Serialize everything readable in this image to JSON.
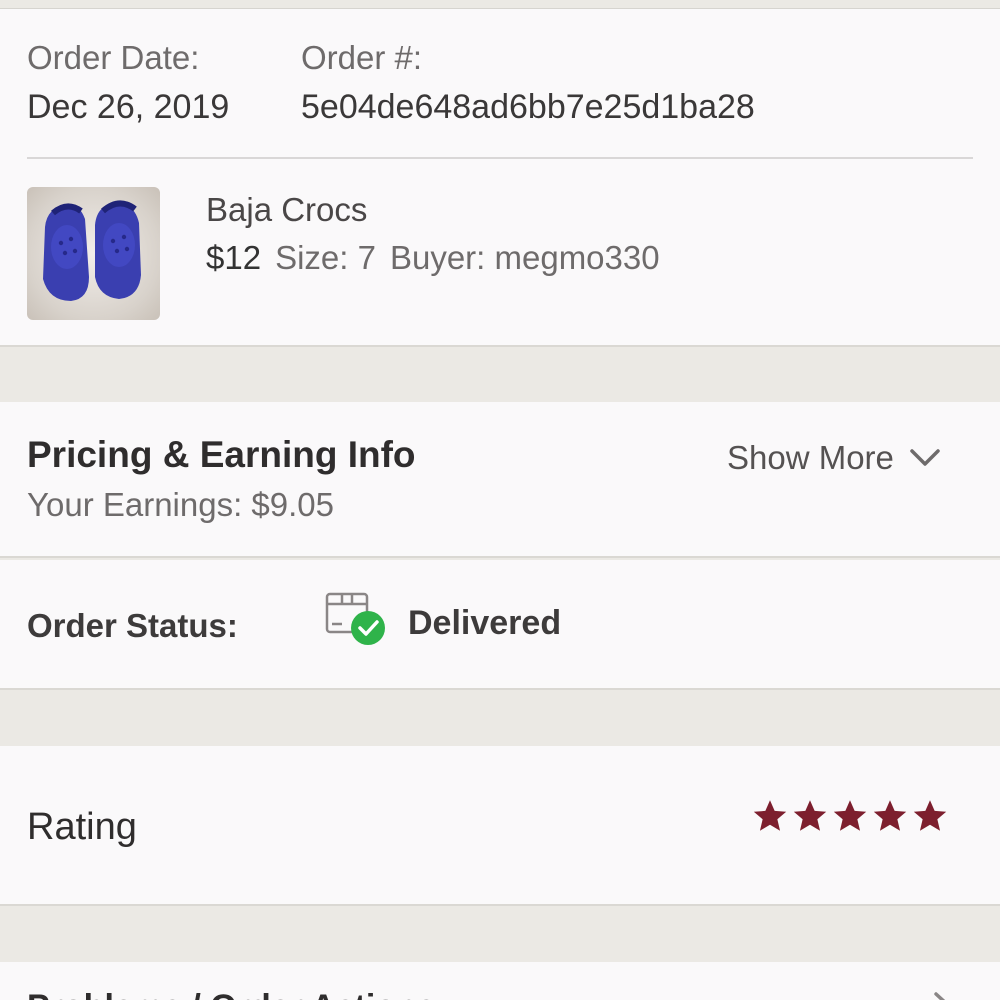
{
  "order": {
    "date_label": "Order Date:",
    "date_value": "Dec 26, 2019",
    "number_label": "Order #:",
    "number_value": "5e04de648ad6bb7e25d1ba28"
  },
  "item": {
    "thumbnail_icon": "crocs-photo",
    "name": "Baja Crocs",
    "price": "$12",
    "size": "Size: 7",
    "buyer": "Buyer: megmo330"
  },
  "pricing": {
    "title": "Pricing & Earning Info",
    "earnings": "Your Earnings: $9.05",
    "show_more": "Show More",
    "chevron_icon": "chevron-down-icon"
  },
  "status": {
    "label": "Order Status:",
    "icon": "delivered-box-icon",
    "value": "Delivered",
    "check_color": "#2fb34a"
  },
  "rating": {
    "label": "Rating",
    "stars": 5,
    "max_stars": 5,
    "star_color": "#7d1f2e"
  },
  "bottom": {
    "label": "Problems / Order Actions"
  }
}
